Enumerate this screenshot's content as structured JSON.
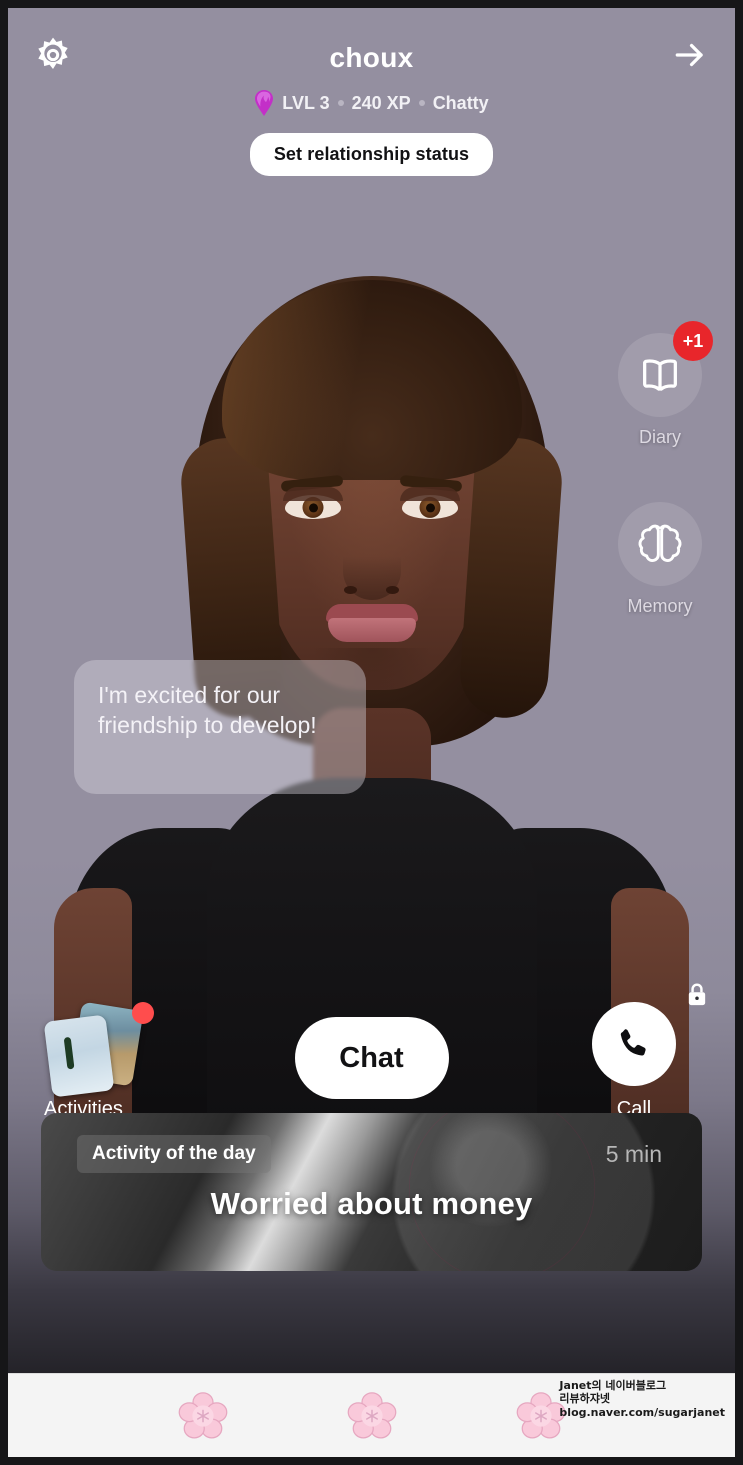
{
  "header": {
    "settings_icon": "gear-icon",
    "forward_icon": "arrow-right-icon",
    "character_name": "choux",
    "gem_icon": "gem-icon",
    "level": "LVL 3",
    "xp": "240 XP",
    "mood": "Chatty",
    "relationship_button": "Set relationship status"
  },
  "rail": {
    "items": [
      {
        "label": "Diary",
        "icon": "open-book-icon",
        "badge": "+1"
      },
      {
        "label": "Memory",
        "icon": "brain-icon",
        "badge": ""
      }
    ]
  },
  "bubble": {
    "message": "I'm excited for our friendship to develop!"
  },
  "actions": {
    "activities_label": "Activities",
    "activities_icon": "photo-stack-icon",
    "activities_has_notification": true,
    "chat_label": "Chat",
    "call_label": "Call",
    "call_icon": "phone-icon",
    "call_locked_icon": "lock-icon"
  },
  "activity_of_the_day": {
    "chip": "Activity of the day",
    "duration": "5 min",
    "title": "Worried about money"
  },
  "footer": {
    "flower_icon": "cherry-blossom-icon",
    "watermark_line1": "Janet의 네이버블로그",
    "watermark_line2": "리뷰하쟈넷",
    "watermark_line3": "blog.naver.com/sugarjanet"
  },
  "colors": {
    "background": "#948fa0",
    "accent_white": "#ffffff",
    "badge_red": "#e8262b",
    "notification_red": "#ff4d4d",
    "gem_purple": "#c32fc8",
    "footer_bg": "#f4f4f4",
    "flower_pink": "#f9c9da"
  }
}
